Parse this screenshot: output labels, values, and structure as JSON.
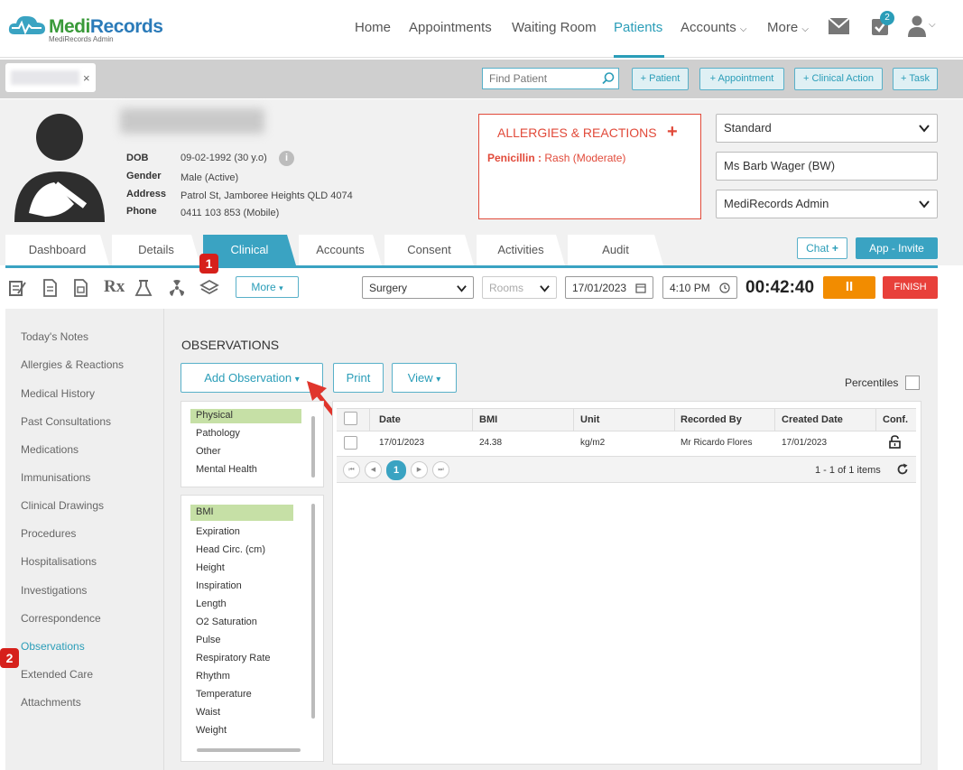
{
  "app": {
    "logo_main": "Medi",
    "logo_accent": "Records",
    "logo_sub": "MediRecords Admin"
  },
  "nav": {
    "items": [
      "Home",
      "Appointments",
      "Waiting Room",
      "Patients",
      "Accounts",
      "More"
    ],
    "active": "Patients",
    "task_badge": "2"
  },
  "toolbar": {
    "tab_close": "×",
    "find_placeholder": "Find Patient",
    "buttons": [
      "+ Patient",
      "+ Appointment",
      "+ Clinical Action",
      "+ Task"
    ]
  },
  "patient": {
    "labels": {
      "dob": "DOB",
      "gender": "Gender",
      "address": "Address",
      "phone": "Phone"
    },
    "dob": "09-02-1992 (30 y.o)",
    "gender": "Male (Active)",
    "address": "Patrol St, Jamboree Heights QLD 4074",
    "phone": "0411 103 853 (Mobile)",
    "info_icon": "i"
  },
  "allergies": {
    "title": "ALLERGIES & REACTIONS",
    "add": "+",
    "item_name": "Penicillin :",
    "item_reaction": " Rash (Moderate)"
  },
  "selectors": {
    "fee": "Standard",
    "practitioner": "Ms Barb Wager (BW)",
    "org": "MediRecords Admin"
  },
  "tabs": [
    "Dashboard",
    "Details",
    "Clinical",
    "Accounts",
    "Consent",
    "Activities",
    "Audit"
  ],
  "tabs_active": "Clinical",
  "actions": {
    "chat": "Chat",
    "chat_plus": "+",
    "app_invite": "App - Invite"
  },
  "clinical_toolbar": {
    "more": "More",
    "rx": "Rx",
    "location": "Surgery",
    "rooms_placeholder": "Rooms",
    "date": "17/01/2023",
    "time": "4:10 PM",
    "timer": "00:42:40",
    "pause": "II",
    "finish": "FINISH"
  },
  "side_nav": {
    "items": [
      "Today's Notes",
      "Allergies & Reactions",
      "Medical History",
      "Past Consultations",
      "Medications",
      "Immunisations",
      "Clinical Drawings",
      "Procedures",
      "Hospitalisations",
      "Investigations",
      "Correspondence",
      "Observations",
      "Extended Care",
      "Attachments"
    ],
    "active": "Observations"
  },
  "observations": {
    "title": "OBSERVATIONS",
    "add_button": "Add Observation",
    "print_button": "Print",
    "view_button": "View",
    "percentiles_label": "Percentiles",
    "categories": [
      "Physical",
      "Pathology",
      "Other",
      "Mental Health"
    ],
    "selected_category": "Physical",
    "types": [
      "BMI",
      "Expiration",
      "Head Circ. (cm)",
      "Height",
      "Inspiration",
      "Length",
      "O2 Saturation",
      "Pulse",
      "Respiratory Rate",
      "Rhythm",
      "Temperature",
      "Waist",
      "Weight"
    ],
    "selected_type": "BMI",
    "grid": {
      "columns": [
        "Date",
        "BMI",
        "Unit",
        "Recorded By",
        "Created Date",
        "Conf."
      ],
      "rows": [
        {
          "date": "17/01/2023",
          "bmi": "24.38",
          "unit": "kg/m2",
          "recorded_by": "Mr Ricardo Flores",
          "created": "17/01/2023"
        }
      ],
      "current_page": "1",
      "pager_first": "⏮",
      "pager_prev": "◀",
      "pager_next": "▶",
      "pager_last": "⏭",
      "items_summary": "1 - 1 of 1 items"
    }
  },
  "markers": [
    "1",
    "2"
  ],
  "colors": {
    "accent": "#2a9db8",
    "alert": "#e14a3a",
    "pause": "#f28c00",
    "finish": "#e8403a",
    "selected": "#c6e0a6"
  }
}
